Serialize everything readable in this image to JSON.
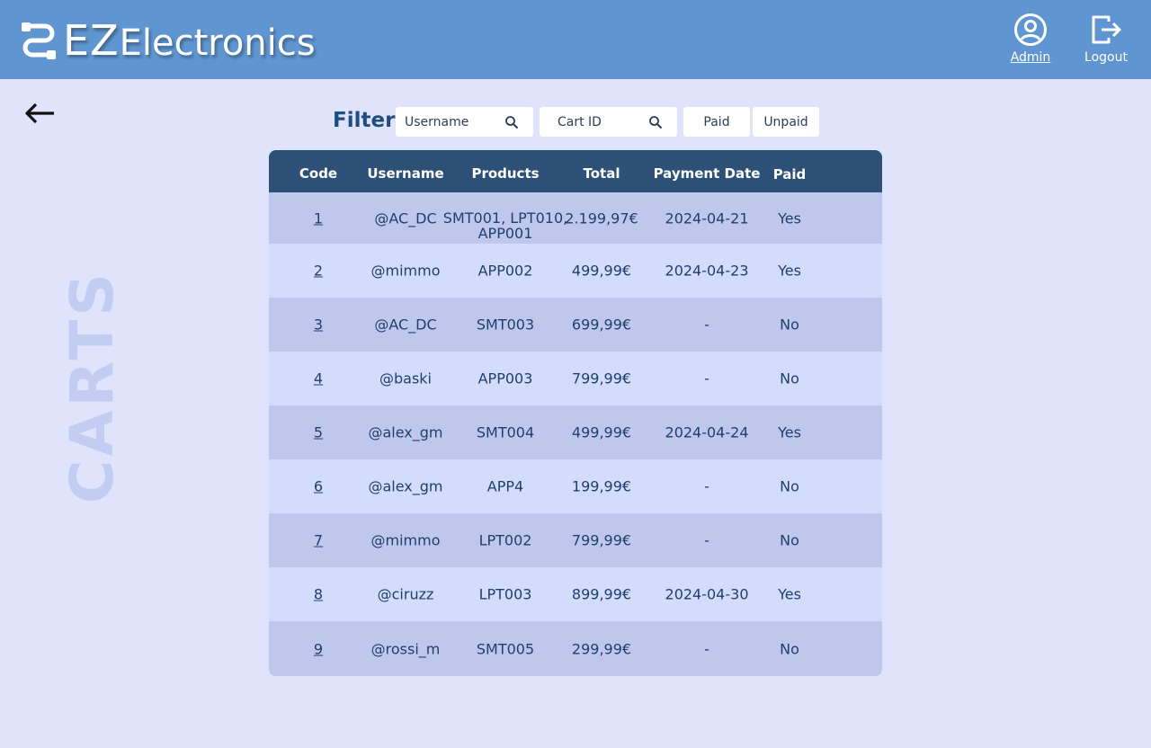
{
  "brand": {
    "ez": "EZ",
    "rest": "Electronics"
  },
  "nav": {
    "admin_label": "Admin",
    "logout_label": "Logout"
  },
  "page": {
    "vertical_title": "CARTS"
  },
  "filter": {
    "label": "Filter",
    "username_placeholder": "Username",
    "cartid_placeholder": "Cart ID",
    "paid_label": "Paid",
    "unpaid_label": "Unpaid"
  },
  "table": {
    "headers": [
      "Code",
      "Username",
      "Products",
      "Total",
      "Payment Date",
      "Paid"
    ],
    "rows": [
      {
        "code": "1",
        "username": "@AC_DC",
        "products": "SMT001, LPT010, APP001",
        "total": "2.199,97€",
        "date": "2024-04-21",
        "paid": "Yes"
      },
      {
        "code": "2",
        "username": "@mimmo",
        "products": "APP002",
        "total": "499,99€",
        "date": "2024-04-23",
        "paid": "Yes"
      },
      {
        "code": "3",
        "username": "@AC_DC",
        "products": "SMT003",
        "total": "699,99€",
        "date": "-",
        "paid": "No"
      },
      {
        "code": "4",
        "username": "@baski",
        "products": "APP003",
        "total": "799,99€",
        "date": "-",
        "paid": "No"
      },
      {
        "code": "5",
        "username": "@alex_gm",
        "products": "SMT004",
        "total": "499,99€",
        "date": "2024-04-24",
        "paid": "Yes"
      },
      {
        "code": "6",
        "username": "@alex_gm",
        "products": "APP4",
        "total": "199,99€",
        "date": "-",
        "paid": "No"
      },
      {
        "code": "7",
        "username": "@mimmo",
        "products": "LPT002",
        "total": "799,99€",
        "date": "-",
        "paid": "No"
      },
      {
        "code": "8",
        "username": "@ciruzz",
        "products": "LPT003",
        "total": "899,99€",
        "date": "2024-04-30",
        "paid": "Yes"
      },
      {
        "code": "9",
        "username": "@rossi_m",
        "products": "SMT005",
        "total": "299,99€",
        "date": "-",
        "paid": "No"
      }
    ]
  },
  "icons": {
    "logo": "ez-logo-icon",
    "admin": "user-circle-icon",
    "logout": "logout-icon",
    "back": "arrow-left-icon",
    "search": "search-icon"
  },
  "colors": {
    "topbar": "#5f96d1",
    "background": "#dfe3fb",
    "table_header": "#2d5077",
    "row_odd": "#bfc8ec",
    "row_even": "#d4dcfc"
  }
}
